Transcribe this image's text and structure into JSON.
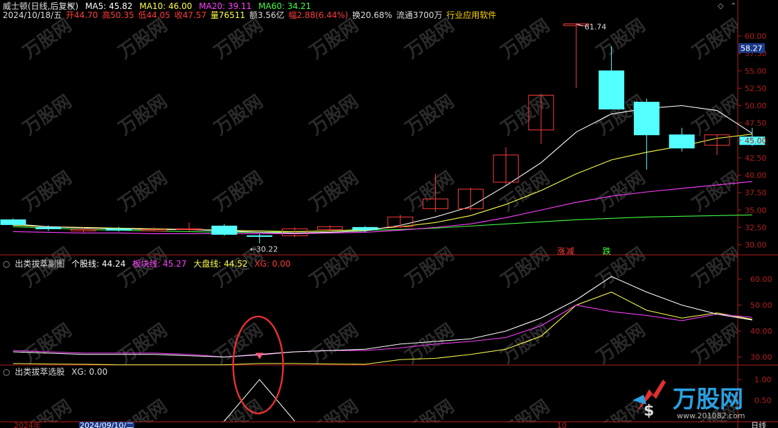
{
  "header": {
    "stock_name": "威士顿(日线,后复权)",
    "ma5": "MA5: 45.82",
    "ma10": "MA10: 46.00",
    "ma20": "MA20: 39.11",
    "ma60": "MA60: 34.21",
    "date": "2024/10/18/五",
    "open": "开44.70",
    "high": "高50.35",
    "low": "低44.05",
    "close": "收47.57",
    "volume": "量76511",
    "amount": "额3.56亿",
    "change": "幅2.88(6.44%)",
    "turnover": "换20.68%",
    "float": "流通3700万",
    "industry": "行业应用软件"
  },
  "sub1": {
    "title": "出类拔萃副图",
    "stock_line": "个股线: 44.24",
    "sector_line": "板块线: 45.27",
    "market_line": "大盘线: 44.52",
    "xg": "XG: 0.00"
  },
  "sub2": {
    "title": "出类拔萃选股",
    "xg": "XG: 0.00"
  },
  "annotations": {
    "high_label": "61.74",
    "low_label": "30.22",
    "current_price": "58.27",
    "limit_up_tag": "涨",
    "reduce_tag": "减",
    "down_tag": "跌"
  },
  "bottom": {
    "year": "2024年",
    "cursor_date": "2024/09/10/二",
    "month": "10",
    "period": "日线"
  },
  "watermark": {
    "brand": "万股网",
    "url": "www.201082.com"
  },
  "colors": {
    "up": "#ff3b3b",
    "down": "#54ffff",
    "ma5": "#ffffff",
    "ma10": "#ffff4a",
    "ma20": "#ff40ff",
    "ma60": "#40ff40",
    "axis": "#b41e1e"
  },
  "chart_data": {
    "type": "candlestick",
    "y_ticks_main": [
      "60.00",
      "57.50",
      "55.00",
      "52.50",
      "50.00",
      "47.50",
      "45.00",
      "42.50",
      "40.00",
      "37.50",
      "35.00",
      "32.50",
      "30.00"
    ],
    "y_ticks_sub1": [
      "60.00",
      "50.00",
      "40.00",
      "30.00"
    ],
    "y_ticks_sub2": [
      "1.00",
      "0.50"
    ],
    "candles": [
      {
        "o": 33.6,
        "c": 32.9,
        "h": 33.8,
        "l": 32.7
      },
      {
        "o": 32.5,
        "c": 32.3,
        "h": 32.8,
        "l": 32.0
      },
      {
        "o": 32.0,
        "c": 32.2,
        "h": 32.5,
        "l": 31.8
      },
      {
        "o": 32.3,
        "c": 32.1,
        "h": 32.6,
        "l": 31.9
      },
      {
        "o": 32.0,
        "c": 32.2,
        "h": 32.5,
        "l": 31.9
      },
      {
        "o": 32.2,
        "c": 32.3,
        "h": 33.2,
        "l": 31.9
      },
      {
        "o": 32.7,
        "c": 31.5,
        "h": 33.0,
        "l": 31.3
      },
      {
        "o": 31.3,
        "c": 31.2,
        "h": 31.6,
        "l": 30.22
      },
      {
        "o": 31.3,
        "c": 32.3,
        "h": 32.5,
        "l": 31.1
      },
      {
        "o": 32.2,
        "c": 32.6,
        "h": 32.8,
        "l": 31.9
      },
      {
        "o": 32.5,
        "c": 32.2,
        "h": 32.7,
        "l": 31.8
      },
      {
        "o": 32.6,
        "c": 34.0,
        "h": 34.3,
        "l": 32.4
      },
      {
        "o": 35.2,
        "c": 36.6,
        "h": 40.2,
        "l": 34.7
      },
      {
        "o": 35.2,
        "c": 38.0,
        "h": 38.2,
        "l": 34.9
      },
      {
        "o": 39.0,
        "c": 42.9,
        "h": 44.0,
        "l": 38.6
      },
      {
        "o": 46.5,
        "c": 51.5,
        "h": 51.5,
        "l": 44.5
      },
      {
        "o": 61.5,
        "c": 61.74,
        "h": 61.74,
        "l": 52.5
      },
      {
        "o": 55.0,
        "c": 49.5,
        "h": 58.5,
        "l": 49.5
      },
      {
        "o": 50.5,
        "c": 45.8,
        "h": 51.0,
        "l": 40.8
      },
      {
        "o": 45.8,
        "c": 43.9,
        "h": 46.8,
        "l": 43.4
      },
      {
        "o": 44.3,
        "c": 45.8,
        "h": 45.8,
        "l": 42.9
      },
      {
        "o": 45.5,
        "c": 44.4,
        "h": 46.8,
        "l": 44.2
      }
    ],
    "ma5": [
      33.0,
      32.6,
      32.4,
      32.3,
      32.2,
      32.2,
      32.0,
      31.8,
      31.7,
      31.8,
      32.0,
      32.8,
      34.0,
      35.5,
      38.5,
      41.8,
      46.2,
      48.8,
      49.6,
      50.0,
      49.3,
      46.0
    ],
    "ma10": [
      32.8,
      32.6,
      32.5,
      32.4,
      32.3,
      32.2,
      32.1,
      32.0,
      31.9,
      32.0,
      32.2,
      32.6,
      33.2,
      34.2,
      35.8,
      37.8,
      40.2,
      42.2,
      43.3,
      44.2,
      45.3,
      45.9
    ],
    "ma20": [
      31.9,
      31.8,
      31.7,
      31.7,
      31.6,
      31.6,
      31.6,
      31.6,
      31.6,
      31.7,
      31.8,
      32.1,
      32.5,
      33.0,
      33.9,
      35.0,
      36.1,
      37.0,
      37.6,
      38.1,
      38.6,
      39.1
    ],
    "ma60": [
      32.6,
      32.4,
      32.2,
      32.1,
      32.0,
      31.9,
      31.8,
      31.8,
      31.9,
      32.0,
      32.1,
      32.2,
      32.4,
      32.7,
      33.0,
      33.3,
      33.6,
      33.8,
      34.0,
      34.1,
      34.2,
      34.3
    ],
    "sub1_stock": [
      32,
      31.5,
      31,
      31,
      31,
      30.5,
      30,
      31,
      32,
      32.5,
      33,
      35,
      36,
      37,
      40,
      45,
      52,
      61,
      55,
      50,
      46.5,
      44.24
    ],
    "sub1_sector": [
      32.5,
      32,
      31.5,
      31.5,
      31.5,
      31,
      30,
      30.8,
      32,
      32.5,
      32.5,
      33.5,
      35,
      36,
      37.5,
      42,
      50,
      47.5,
      46,
      44,
      46.5,
      45.27
    ],
    "sub1_market": [
      27.5,
      27.3,
      27.2,
      27,
      27,
      27,
      27,
      27.5,
      27.5,
      27.3,
      27.2,
      29,
      29.5,
      31,
      33,
      38,
      50,
      55,
      48,
      45,
      47,
      44.52
    ],
    "sub1_marker_index": 7,
    "sub2_xg": [
      0,
      0,
      0,
      0,
      0,
      0,
      0,
      1,
      0,
      0,
      0,
      0,
      0,
      0,
      0,
      0,
      0,
      0,
      0,
      0,
      0,
      0
    ]
  }
}
